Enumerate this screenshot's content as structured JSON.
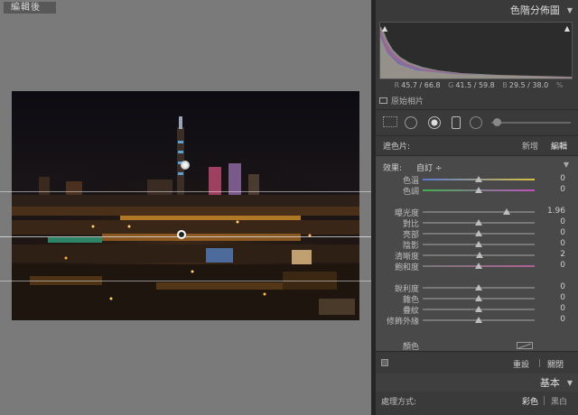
{
  "canvas": {
    "view_label": "編輯後"
  },
  "histogram": {
    "title": "色階分佈圖",
    "values": {
      "r_label": "R",
      "r_value": "45.7 / 66.8",
      "g_label": "G",
      "g_value": "41.5 / 59.8",
      "b_label": "B",
      "b_value": "29.5 / 38.0",
      "unit": "%"
    },
    "original_photo_label": "原始相片"
  },
  "mask": {
    "label": "遮色片:",
    "new_label": "新增",
    "edit_label": "編輯"
  },
  "adjust": {
    "effect_label": "效果:",
    "effect_value": "自訂 ÷",
    "color_label": "顏色",
    "sliders": [
      {
        "label": "色溫",
        "value": "0",
        "position": 0.5
      },
      {
        "label": "色調",
        "value": "0",
        "position": 0.5
      },
      {
        "label": "曝光度",
        "value": "1.96",
        "position": 0.75
      },
      {
        "label": "對比",
        "value": "0",
        "position": 0.5
      },
      {
        "label": "亮部",
        "value": "0",
        "position": 0.5
      },
      {
        "label": "陰影",
        "value": "0",
        "position": 0.5
      },
      {
        "label": "清晰度",
        "value": "2",
        "position": 0.51
      },
      {
        "label": "飽和度",
        "value": "0",
        "position": 0.5
      },
      {
        "label": "銳利度",
        "value": "0",
        "position": 0.5
      },
      {
        "label": "雜色",
        "value": "0",
        "position": 0.5
      },
      {
        "label": "疊紋",
        "value": "0",
        "position": 0.5
      },
      {
        "label": "修飾外緣",
        "value": "0",
        "position": 0.5
      }
    ]
  },
  "bottom_bar": {
    "reset_label": "重設",
    "close_label": "關閉"
  },
  "basic": {
    "title": "基本",
    "treatment_label": "處理方式:",
    "color_option": "彩色",
    "bw_option": "黑白"
  }
}
